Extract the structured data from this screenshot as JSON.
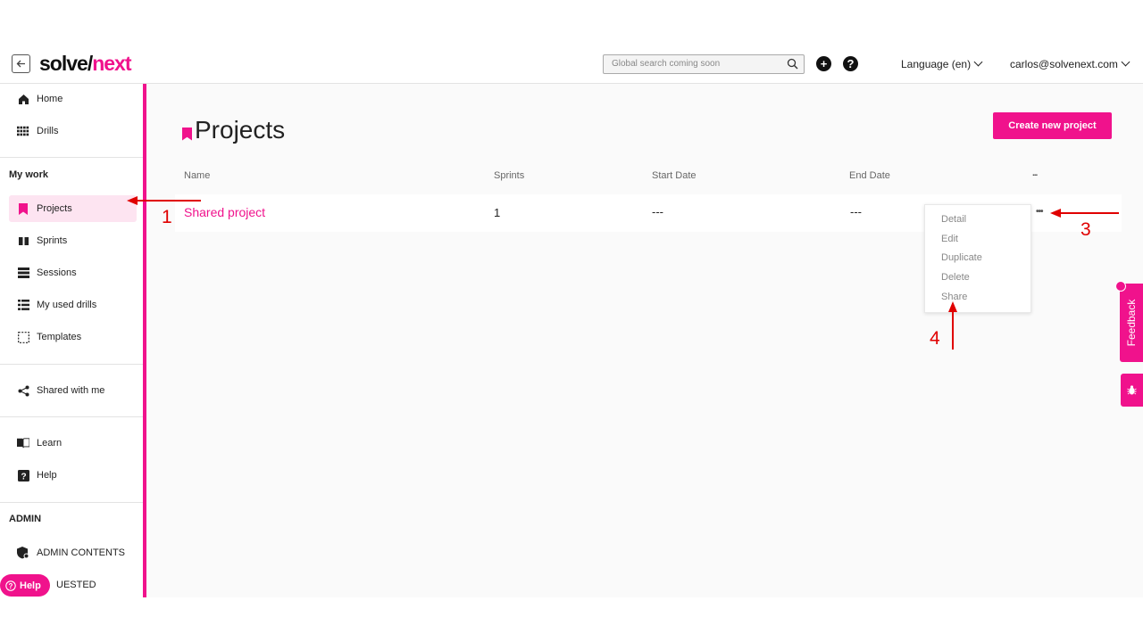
{
  "header": {
    "logo_part1": "solve/",
    "logo_part2": "next",
    "search_placeholder": "Global search coming soon",
    "language": "Language (en)",
    "user_email": "carlos@solvenext.com"
  },
  "sidebar": {
    "items_top": [
      {
        "label": "Home",
        "icon": "home-icon"
      },
      {
        "label": "Drills",
        "icon": "grid-icon"
      }
    ],
    "my_work_title": "My work",
    "my_work_items": [
      {
        "label": "Projects",
        "icon": "bookmark-icon",
        "active": true
      },
      {
        "label": "Sprints",
        "icon": "sprints-icon"
      },
      {
        "label": "Sessions",
        "icon": "sessions-icon"
      },
      {
        "label": "My used drills",
        "icon": "list-icon"
      },
      {
        "label": "Templates",
        "icon": "template-icon"
      }
    ],
    "shared_label": "Shared with me",
    "learn_label": "Learn",
    "help_label": "Help",
    "admin_title": "ADMIN",
    "admin_contents_label": "ADMIN CONTENTS",
    "requested_label": "UESTED"
  },
  "main": {
    "page_title": "Projects",
    "create_button": "Create new project",
    "columns": [
      "Name",
      "Sprints",
      "Start Date",
      "End Date",
      "..."
    ],
    "rows": [
      {
        "name": "Shared project",
        "sprints": "1",
        "start_date": "---",
        "end_date": "---"
      }
    ],
    "row_menu": [
      "Detail",
      "Edit",
      "Duplicate",
      "Delete",
      "Share"
    ]
  },
  "feedback_label": "Feedback",
  "help_pill_label": "Help",
  "annotations": [
    "1",
    "3",
    "4"
  ],
  "colors": {
    "accent": "#f0128c",
    "annotation": "#e00000"
  }
}
